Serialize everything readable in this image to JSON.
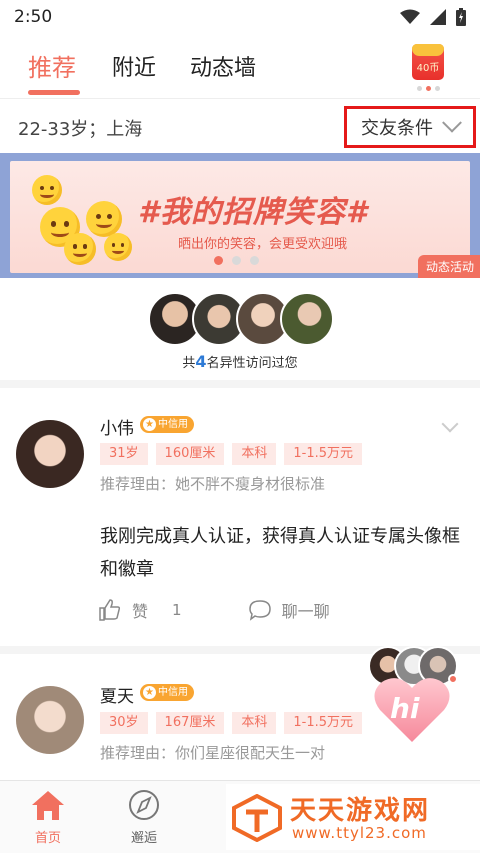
{
  "status_bar": {
    "time": "2:50"
  },
  "top_tabs": [
    {
      "label": "推荐",
      "active": true
    },
    {
      "label": "附近",
      "active": false
    },
    {
      "label": "动态墙",
      "active": false
    }
  ],
  "redpacket": {
    "label": "40币"
  },
  "filter": {
    "summary": "22-33岁；上海",
    "button_label": "交友条件"
  },
  "banner": {
    "title": "#我的招牌笑容#",
    "subtitle": "晒出你的笑容，会更受欢迎哦",
    "tag": "动态活动",
    "active_dot": 0,
    "dot_count": 3
  },
  "visitors": {
    "prefix": "共",
    "count": "4",
    "suffix": "名异性访问过您"
  },
  "cards": [
    {
      "name": "小伟",
      "badge": "中信用",
      "tags": [
        "31岁",
        "160厘米",
        "本科",
        "1-1.5万元"
      ],
      "reason": "推荐理由：她不胖不瘦身材很标准",
      "post": "我刚完成真人认证，获得真人认证专属头像框和徽章",
      "like_label": "赞",
      "like_count": "1",
      "chat_label": "聊一聊"
    },
    {
      "name": "夏天",
      "badge": "中信用",
      "tags": [
        "30岁",
        "167厘米",
        "本科",
        "1-1.5万元"
      ],
      "reason": "推荐理由：你们星座很配天生一对"
    }
  ],
  "float_button": {
    "label": "hi"
  },
  "bottom_nav": [
    {
      "label": "首页",
      "active": true
    },
    {
      "label": "邂逅",
      "active": false
    }
  ],
  "watermark": {
    "title": "天天游戏网",
    "url": "www.ttyl23.com"
  },
  "colors": {
    "accent": "#f1705f",
    "highlight_border": "#e51919",
    "badge": "#f9a531",
    "visitor_count": "#2d7ad6"
  }
}
